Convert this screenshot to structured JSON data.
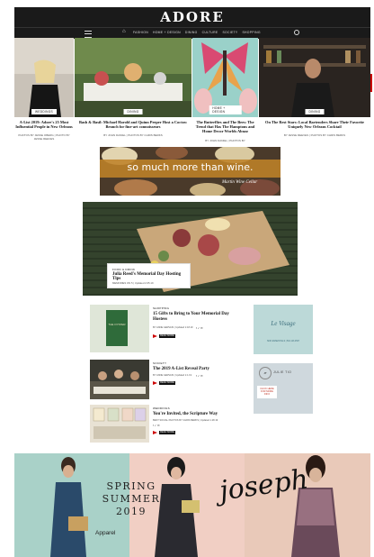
{
  "site": {
    "logo": "ADORE"
  },
  "nav": {
    "items": [
      "FASHION",
      "HOME + DESIGN",
      "DINING",
      "CULTURE",
      "SOCIETY",
      "SHOPPING"
    ],
    "home_icon": "⌂"
  },
  "heroes": [
    {
      "badge": "WEDDINGS",
      "title": "A-List 2019: Adore's 25 Most Influential People in New Orleans",
      "byline": "PHOTOS BY JESSE OBERG | PHOTO BY JESSE REEVES"
    },
    {
      "badge": "DINING",
      "title": "Bash & Basil: Michael Harold and Quinn Peeper Host a Coctow Brunch for fine-art connoisseurs",
      "byline": "BY JOHN DANIEL | PHOTOS BY CHRIS BERKS"
    },
    {
      "badge": "HOME + DESIGN",
      "title": "The Butterflies and The Bees: The Trend that Has The Hamptons and Home Decor Worlds Abuzz",
      "byline": "BY JOHN DANIEL | PHOTOS BY"
    },
    {
      "badge": "DINING",
      "title": "On The Rest Stars: Local Bartenders Share Their Favorite Uniquely New Orleans Cocktail",
      "byline": "BY JESSE REEVES | PHOTOS BY CHRIS BERKS"
    }
  ],
  "wine_ad": {
    "text": "so much more than wine.",
    "brand": "Martin Wine Cellar"
  },
  "feature": {
    "category": "FOOD & DRINK",
    "title": "Julia Reed's Memorial Day Hosting Tips",
    "byline": "MEMORIES ON 5 | Updated 2.05.19"
  },
  "articles": [
    {
      "category": "SHOPPING",
      "title": "15 Gifts to Bring to Your Memorial Day Hostess",
      "byline": "BY ANNE GERVAIS | Updated 2.18.19",
      "read": "READ MORE",
      "thumb_text": "THE OYSTER"
    },
    {
      "category": "SOCIETY",
      "title": "The 2019 A-List Reveal Party",
      "byline": "BY ANNE GERVAIS | Updated 2.1.19",
      "read": "READ MORE"
    },
    {
      "category": "WEDDINGS",
      "title": "You're Invited, the Scripture Way",
      "byline": "BEST SOCIAL PHOTOS BY CHRIS BERKS | Updated 1.28.19",
      "read": "READ MORE"
    }
  ],
  "social": "f  ✓  ✉",
  "side_ads": [
    {
      "title": "Le Visage",
      "sub": "SKIN ESSENTIALS | 504.123.4567"
    },
    {
      "logo": "JT",
      "name": "JULIE TIO",
      "cta": "CLICK HERE FOR MORE INFO"
    }
  ],
  "banner": {
    "line1": "SPRING",
    "line2": "SUMMER",
    "line3": "2019",
    "apparel": "Apparel",
    "brand": "joseph"
  },
  "colors": {
    "dark": "#1a1a1a",
    "accent_red": "#cc0000",
    "wine_band": "#be8228"
  }
}
